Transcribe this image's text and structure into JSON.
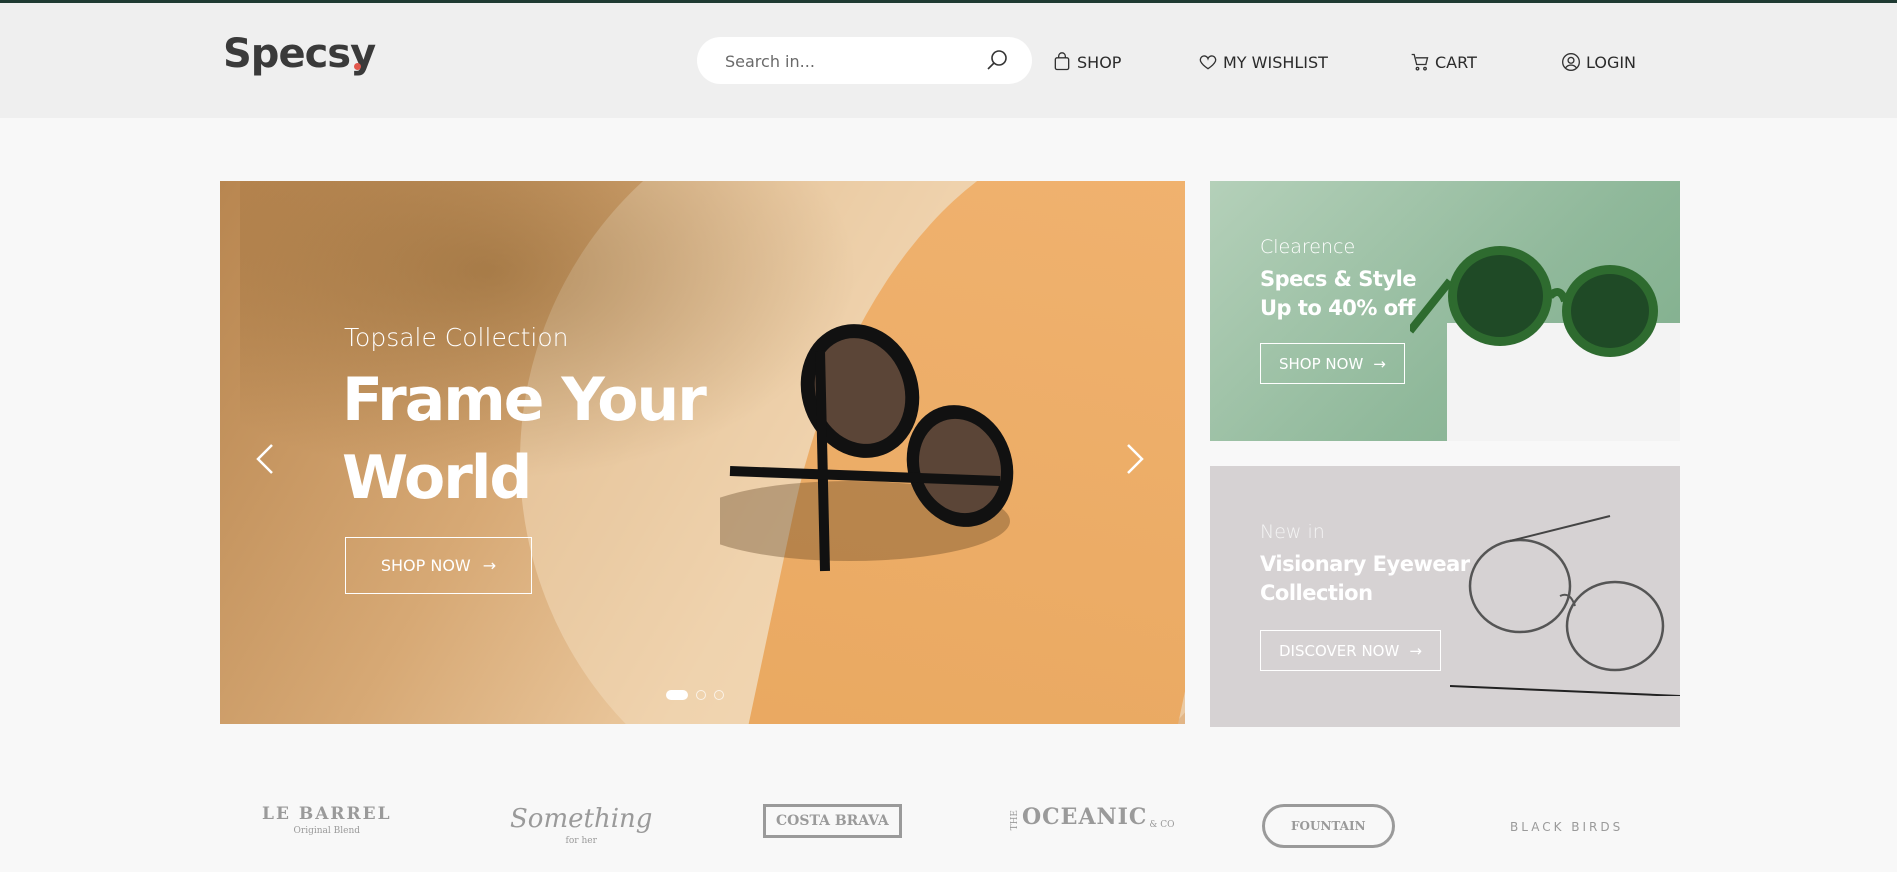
{
  "header": {
    "logo": "Specsy",
    "search_placeholder": "Search in...",
    "nav": [
      {
        "label": "SHOP",
        "icon": "shopping-bag-icon"
      },
      {
        "label": "MY WISHLIST",
        "icon": "heart-icon"
      },
      {
        "label": "CART",
        "icon": "cart-icon"
      },
      {
        "label": "LOGIN",
        "icon": "user-icon"
      }
    ]
  },
  "hero": {
    "subtitle": "Topsale Collection",
    "title": "Frame Your World",
    "button": "SHOP NOW",
    "slides": 3,
    "active_slide": 1
  },
  "promos": [
    {
      "subtitle": "Clearence",
      "title_line1": "Specs & Style",
      "title_line2": "Up to 40% off",
      "button": "SHOP NOW"
    },
    {
      "subtitle": "New in",
      "title_line1": "Visionary Eyewear",
      "title_line2": "Collection",
      "button": "DISCOVER NOW"
    }
  ],
  "brands": [
    {
      "name": "LE BARREL",
      "tagline": "Original Blend"
    },
    {
      "name": "Something",
      "tagline": "for her"
    },
    {
      "name": "COSTA BRAVA",
      "tagline": ""
    },
    {
      "name": "OCEANIC",
      "tagline": "& CO",
      "prefix": "THE"
    },
    {
      "name": "FOUNTAIN",
      "tagline": ""
    },
    {
      "name": "BLACK BIRDS",
      "tagline": ""
    }
  ],
  "colors": {
    "accent": "#e2574c",
    "top_bar": "#1f3a32",
    "header_bg": "#efefef"
  }
}
